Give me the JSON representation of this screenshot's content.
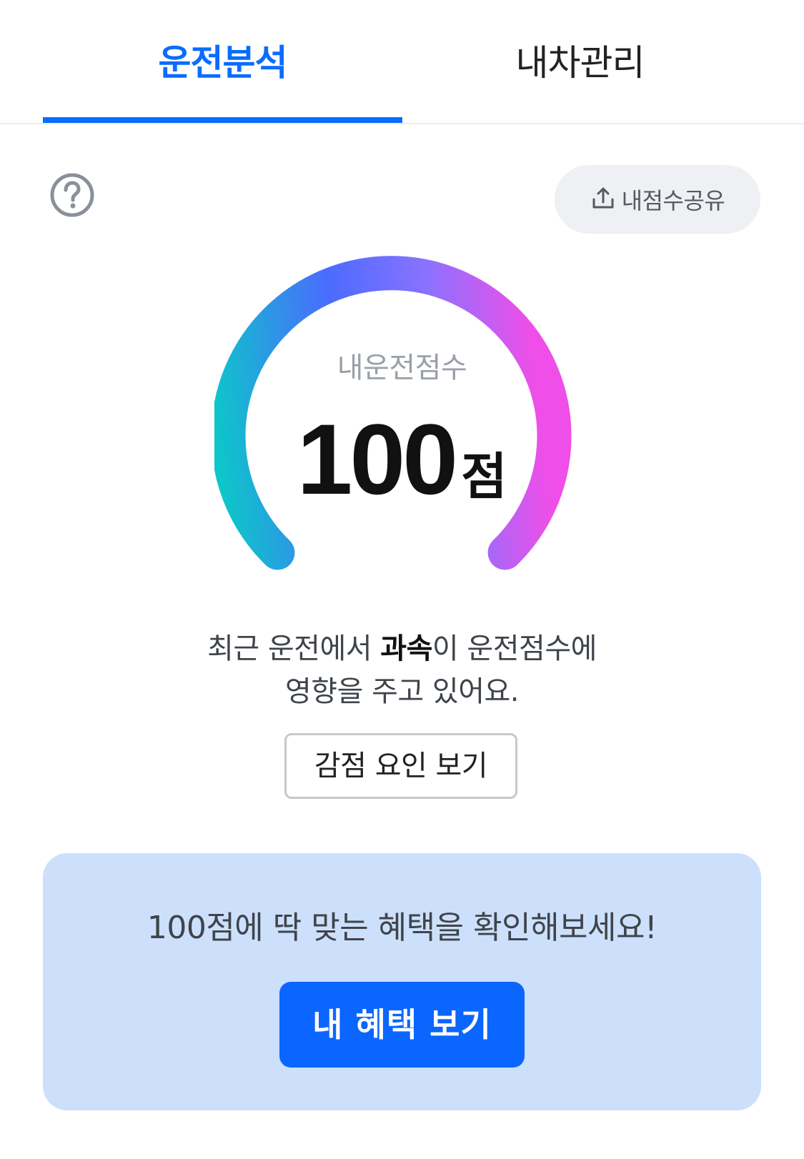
{
  "tabs": [
    {
      "label": "운전분석",
      "active": true
    },
    {
      "label": "내차관리",
      "active": false
    }
  ],
  "header": {
    "help_icon": "question-circle-icon",
    "share_label": "내점수공유",
    "share_icon": "share-upload-icon"
  },
  "gauge": {
    "caption": "내운전점수",
    "score": "100",
    "unit": "점",
    "fraction": 1.0,
    "gradient": [
      "#0cc7c9",
      "#4b6bff",
      "#8a72ff",
      "#f04ee8"
    ]
  },
  "message": {
    "line1_prefix": "최근 운전에서 ",
    "line1_bold": "과속",
    "line1_suffix": "이 운전점수에",
    "line2": "영향을 주고 있어요."
  },
  "deduct_button": "감점 요인 보기",
  "benefit": {
    "text": "100점에 딱 맞는 혜택을 확인해보세요!",
    "button": "내 혜택 보기"
  },
  "colors": {
    "accent": "#0a6cff",
    "benefit_bg": "#cde0fb"
  }
}
